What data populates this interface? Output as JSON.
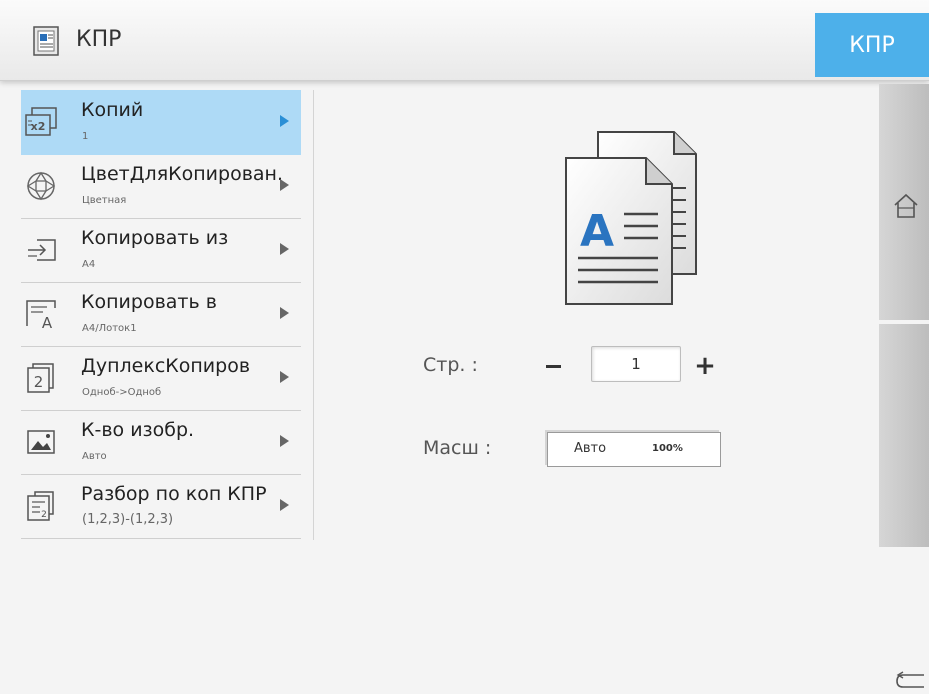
{
  "header": {
    "title": "КПР",
    "right_button": "КПР",
    "accent_color": "#4db0ea"
  },
  "menu": {
    "items": [
      {
        "label": "Копий",
        "value": "1",
        "icon": "copies-x2-icon",
        "selected": true
      },
      {
        "label": "ЦветДляКопирован.",
        "value": "Цветная",
        "icon": "color-mode-icon"
      },
      {
        "label": "Копировать из",
        "value": "A4",
        "icon": "copy-from-icon"
      },
      {
        "label": "Копировать в",
        "value": "A4/Лоток1",
        "icon": "copy-to-icon"
      },
      {
        "label": "ДуплексКопиров",
        "value": "Одноб->Одноб",
        "icon": "duplex-icon"
      },
      {
        "label": "К-во изобр.",
        "value": "Авто",
        "icon": "image-count-icon"
      },
      {
        "label": "Разбор по коп КПР",
        "value": "(1,2,3)-(1,2,3)",
        "icon": "collate-icon"
      }
    ]
  },
  "main": {
    "pages_label": "Стр. :",
    "pages_value": "1",
    "scale_label": "Масш :",
    "scale_mode": "Авто",
    "scale_percent": "100%"
  },
  "rail": {
    "icons": [
      "home-icon",
      "back-icon"
    ]
  }
}
